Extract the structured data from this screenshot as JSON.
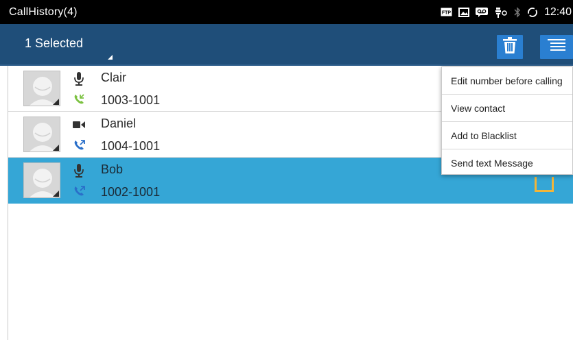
{
  "statusbar": {
    "title": "CallHistory(4)",
    "time": "12:40",
    "icons": [
      "ftp-icon",
      "image-icon",
      "voicemail-icon",
      "usb-debug-icon",
      "bluetooth-icon",
      "sync-icon"
    ]
  },
  "actionbar": {
    "selected_label": "1 Selected",
    "buttons": [
      "trash-icon",
      "overflow-menu-icon"
    ]
  },
  "calls": [
    {
      "name": "Clair",
      "number": "1003-1001",
      "type_icon": "microphone-icon",
      "direction_icon": "incoming-call-icon",
      "direction_color": "#7cc242",
      "selected": false
    },
    {
      "name": "Daniel",
      "number": "1004-1001",
      "type_icon": "video-camera-icon",
      "direction_icon": "outgoing-call-icon",
      "direction_color": "#2a6fc9",
      "selected": false
    },
    {
      "name": "Bob",
      "number": "1002-1001",
      "type_icon": "microphone-icon",
      "direction_icon": "outgoing-call-icon",
      "direction_color": "#2a6fc9",
      "selected": true
    }
  ],
  "menu": {
    "items": [
      "Edit number before calling",
      "View contact",
      "Add to Blacklist",
      "Send text Message"
    ]
  },
  "colors": {
    "actionbar": "#1f4e79",
    "button": "#2a7fd1",
    "selected_row": "#35a6d6",
    "checkbox": "#f2b53a"
  }
}
